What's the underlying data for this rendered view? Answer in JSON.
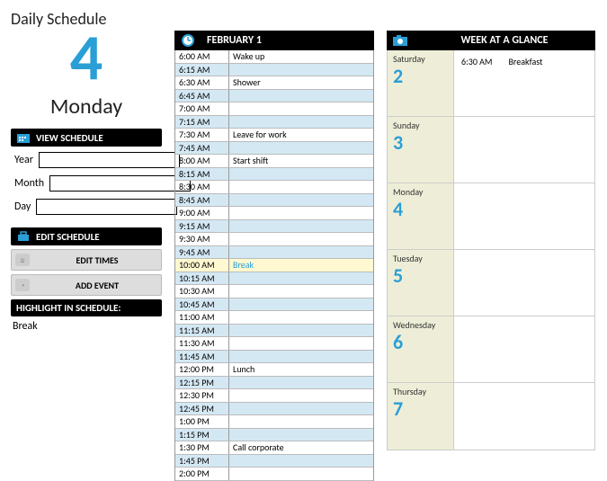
{
  "title": "Daily Schedule",
  "bigDay": "4",
  "dayName": "Monday",
  "viewBar": "VIEW SCHEDULE",
  "fields": [
    {
      "label": "Year"
    },
    {
      "label": "Month"
    },
    {
      "label": "Day"
    }
  ],
  "editBar": "EDIT SCHEDULE",
  "btnEditTimes": "EDIT TIMES",
  "btnAddEvent": "ADD EVENT",
  "hlBar": "HIGHLIGHT IN SCHEDULE:",
  "hlValue": "Break",
  "midTitle": "FEBRUARY 1",
  "schedule": [
    {
      "t": "6:00 AM",
      "e": "Wake up"
    },
    {
      "t": "6:15 AM",
      "e": ""
    },
    {
      "t": "6:30 AM",
      "e": "Shower"
    },
    {
      "t": "6:45 AM",
      "e": ""
    },
    {
      "t": "7:00 AM",
      "e": ""
    },
    {
      "t": "7:15 AM",
      "e": ""
    },
    {
      "t": "7:30 AM",
      "e": "Leave for work"
    },
    {
      "t": "7:45 AM",
      "e": ""
    },
    {
      "t": "8:00 AM",
      "e": "Start shift"
    },
    {
      "t": "8:15 AM",
      "e": ""
    },
    {
      "t": "8:30 AM",
      "e": ""
    },
    {
      "t": "8:45 AM",
      "e": ""
    },
    {
      "t": "9:00 AM",
      "e": ""
    },
    {
      "t": "9:15 AM",
      "e": ""
    },
    {
      "t": "9:30 AM",
      "e": ""
    },
    {
      "t": "9:45 AM",
      "e": ""
    },
    {
      "t": "10:00 AM",
      "e": "Break",
      "hl": true
    },
    {
      "t": "10:15 AM",
      "e": ""
    },
    {
      "t": "10:30 AM",
      "e": ""
    },
    {
      "t": "10:45 AM",
      "e": ""
    },
    {
      "t": "11:00 AM",
      "e": ""
    },
    {
      "t": "11:15 AM",
      "e": ""
    },
    {
      "t": "11:30 AM",
      "e": ""
    },
    {
      "t": "11:45 AM",
      "e": ""
    },
    {
      "t": "12:00 PM",
      "e": "Lunch"
    },
    {
      "t": "12:15 PM",
      "e": ""
    },
    {
      "t": "12:30 PM",
      "e": ""
    },
    {
      "t": "12:45 PM",
      "e": ""
    },
    {
      "t": "1:00 PM",
      "e": ""
    },
    {
      "t": "1:15 PM",
      "e": ""
    },
    {
      "t": "1:30 PM",
      "e": "Call corporate"
    },
    {
      "t": "1:45 PM",
      "e": ""
    },
    {
      "t": "2:00 PM",
      "e": ""
    }
  ],
  "weekTitle": "WEEK AT A GLANCE",
  "week": [
    {
      "day": "Saturday",
      "num": "2",
      "evt": "6:30 AM",
      "evd": "Breakfast"
    },
    {
      "day": "Sunday",
      "num": "3"
    },
    {
      "day": "Monday",
      "num": "4"
    },
    {
      "day": "Tuesday",
      "num": "5"
    },
    {
      "day": "Wednesday",
      "num": "6"
    },
    {
      "day": "Thursday",
      "num": "7"
    }
  ]
}
